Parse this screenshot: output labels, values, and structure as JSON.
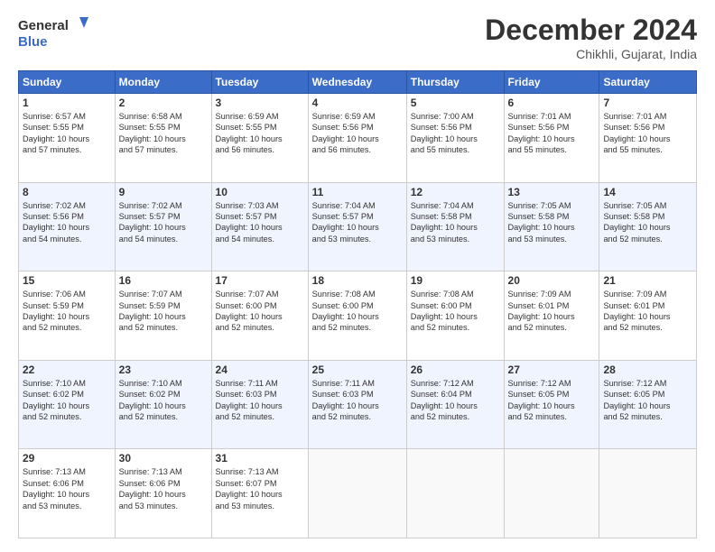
{
  "header": {
    "logo_line1": "General",
    "logo_line2": "Blue",
    "month_title": "December 2024",
    "location": "Chikhli, Gujarat, India"
  },
  "days_of_week": [
    "Sunday",
    "Monday",
    "Tuesday",
    "Wednesday",
    "Thursday",
    "Friday",
    "Saturday"
  ],
  "weeks": [
    [
      {
        "day": "1",
        "text": "Sunrise: 6:57 AM\nSunset: 5:55 PM\nDaylight: 10 hours\nand 57 minutes."
      },
      {
        "day": "2",
        "text": "Sunrise: 6:58 AM\nSunset: 5:55 PM\nDaylight: 10 hours\nand 57 minutes."
      },
      {
        "day": "3",
        "text": "Sunrise: 6:59 AM\nSunset: 5:55 PM\nDaylight: 10 hours\nand 56 minutes."
      },
      {
        "day": "4",
        "text": "Sunrise: 6:59 AM\nSunset: 5:56 PM\nDaylight: 10 hours\nand 56 minutes."
      },
      {
        "day": "5",
        "text": "Sunrise: 7:00 AM\nSunset: 5:56 PM\nDaylight: 10 hours\nand 55 minutes."
      },
      {
        "day": "6",
        "text": "Sunrise: 7:01 AM\nSunset: 5:56 PM\nDaylight: 10 hours\nand 55 minutes."
      },
      {
        "day": "7",
        "text": "Sunrise: 7:01 AM\nSunset: 5:56 PM\nDaylight: 10 hours\nand 55 minutes."
      }
    ],
    [
      {
        "day": "8",
        "text": "Sunrise: 7:02 AM\nSunset: 5:56 PM\nDaylight: 10 hours\nand 54 minutes."
      },
      {
        "day": "9",
        "text": "Sunrise: 7:02 AM\nSunset: 5:57 PM\nDaylight: 10 hours\nand 54 minutes."
      },
      {
        "day": "10",
        "text": "Sunrise: 7:03 AM\nSunset: 5:57 PM\nDaylight: 10 hours\nand 54 minutes."
      },
      {
        "day": "11",
        "text": "Sunrise: 7:04 AM\nSunset: 5:57 PM\nDaylight: 10 hours\nand 53 minutes."
      },
      {
        "day": "12",
        "text": "Sunrise: 7:04 AM\nSunset: 5:58 PM\nDaylight: 10 hours\nand 53 minutes."
      },
      {
        "day": "13",
        "text": "Sunrise: 7:05 AM\nSunset: 5:58 PM\nDaylight: 10 hours\nand 53 minutes."
      },
      {
        "day": "14",
        "text": "Sunrise: 7:05 AM\nSunset: 5:58 PM\nDaylight: 10 hours\nand 52 minutes."
      }
    ],
    [
      {
        "day": "15",
        "text": "Sunrise: 7:06 AM\nSunset: 5:59 PM\nDaylight: 10 hours\nand 52 minutes."
      },
      {
        "day": "16",
        "text": "Sunrise: 7:07 AM\nSunset: 5:59 PM\nDaylight: 10 hours\nand 52 minutes."
      },
      {
        "day": "17",
        "text": "Sunrise: 7:07 AM\nSunset: 6:00 PM\nDaylight: 10 hours\nand 52 minutes."
      },
      {
        "day": "18",
        "text": "Sunrise: 7:08 AM\nSunset: 6:00 PM\nDaylight: 10 hours\nand 52 minutes."
      },
      {
        "day": "19",
        "text": "Sunrise: 7:08 AM\nSunset: 6:00 PM\nDaylight: 10 hours\nand 52 minutes."
      },
      {
        "day": "20",
        "text": "Sunrise: 7:09 AM\nSunset: 6:01 PM\nDaylight: 10 hours\nand 52 minutes."
      },
      {
        "day": "21",
        "text": "Sunrise: 7:09 AM\nSunset: 6:01 PM\nDaylight: 10 hours\nand 52 minutes."
      }
    ],
    [
      {
        "day": "22",
        "text": "Sunrise: 7:10 AM\nSunset: 6:02 PM\nDaylight: 10 hours\nand 52 minutes."
      },
      {
        "day": "23",
        "text": "Sunrise: 7:10 AM\nSunset: 6:02 PM\nDaylight: 10 hours\nand 52 minutes."
      },
      {
        "day": "24",
        "text": "Sunrise: 7:11 AM\nSunset: 6:03 PM\nDaylight: 10 hours\nand 52 minutes."
      },
      {
        "day": "25",
        "text": "Sunrise: 7:11 AM\nSunset: 6:03 PM\nDaylight: 10 hours\nand 52 minutes."
      },
      {
        "day": "26",
        "text": "Sunrise: 7:12 AM\nSunset: 6:04 PM\nDaylight: 10 hours\nand 52 minutes."
      },
      {
        "day": "27",
        "text": "Sunrise: 7:12 AM\nSunset: 6:05 PM\nDaylight: 10 hours\nand 52 minutes."
      },
      {
        "day": "28",
        "text": "Sunrise: 7:12 AM\nSunset: 6:05 PM\nDaylight: 10 hours\nand 52 minutes."
      }
    ],
    [
      {
        "day": "29",
        "text": "Sunrise: 7:13 AM\nSunset: 6:06 PM\nDaylight: 10 hours\nand 53 minutes."
      },
      {
        "day": "30",
        "text": "Sunrise: 7:13 AM\nSunset: 6:06 PM\nDaylight: 10 hours\nand 53 minutes."
      },
      {
        "day": "31",
        "text": "Sunrise: 7:13 AM\nSunset: 6:07 PM\nDaylight: 10 hours\nand 53 minutes."
      },
      {
        "day": "",
        "text": ""
      },
      {
        "day": "",
        "text": ""
      },
      {
        "day": "",
        "text": ""
      },
      {
        "day": "",
        "text": ""
      }
    ]
  ]
}
